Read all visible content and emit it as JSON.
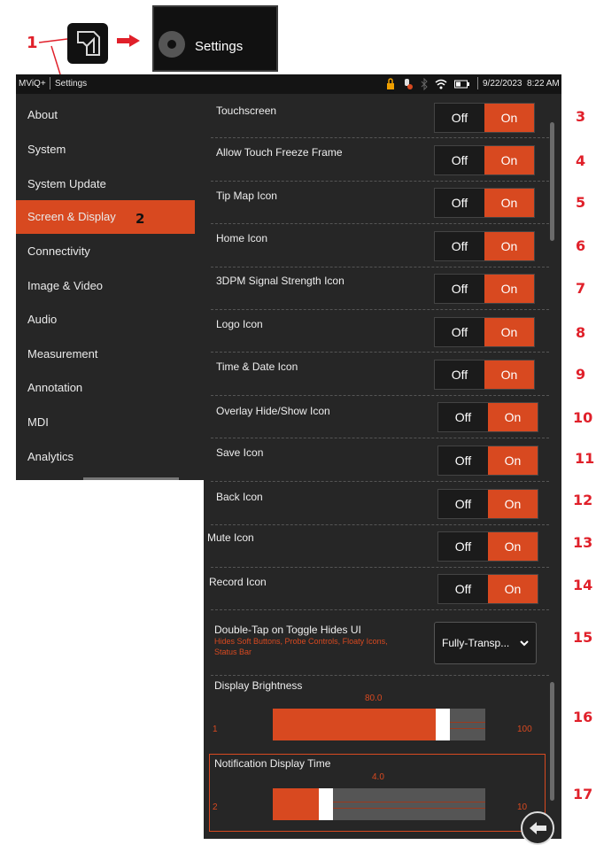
{
  "callouts": {
    "c1": "1",
    "c2": "2",
    "c3": "3",
    "c4": "4",
    "c5": "5",
    "c6": "6",
    "c7": "7",
    "c8": "8",
    "c9": "9",
    "c10": "10",
    "c11": "11",
    "c12": "12",
    "c13": "13",
    "c14": "14",
    "c15": "15",
    "c16": "16",
    "c17": "17"
  },
  "settings_tile": {
    "label": "Settings"
  },
  "statusbar": {
    "app": "MViQ+",
    "section": "Settings",
    "datetime": "9/22/2023  8:22 AM"
  },
  "sidebar": {
    "items": [
      {
        "label": "About"
      },
      {
        "label": "System"
      },
      {
        "label": "System Update"
      },
      {
        "label": "Screen & Display"
      },
      {
        "label": "Connectivity"
      },
      {
        "label": "Image & Video"
      },
      {
        "label": "Audio"
      },
      {
        "label": "Measurement"
      },
      {
        "label": "Annotation"
      },
      {
        "label": "MDI"
      },
      {
        "label": "Analytics"
      }
    ]
  },
  "toggle_labels": {
    "off": "Off",
    "on": "On"
  },
  "rows": [
    {
      "label": "Touchscreen"
    },
    {
      "label": "Allow Touch Freeze Frame"
    },
    {
      "label": "Tip Map Icon"
    },
    {
      "label": "Home Icon"
    },
    {
      "label": "3DPM Signal Strength Icon"
    },
    {
      "label": "Logo Icon"
    },
    {
      "label": "Time & Date Icon"
    },
    {
      "label": "Overlay Hide/Show Icon"
    },
    {
      "label": "Save Icon"
    },
    {
      "label": "Back Icon"
    },
    {
      "label": "Mute Icon"
    },
    {
      "label": "Record Icon"
    }
  ],
  "double_tap": {
    "label": "Double-Tap on Toggle Hides UI",
    "sub1": "Hides Soft Buttons, Probe Controls, Floaty Icons,",
    "sub2": "Status Bar",
    "value": "Fully-Transp..."
  },
  "brightness": {
    "label": "Display Brightness",
    "value": "80.0",
    "min": "1",
    "max": "100",
    "fraction": 0.8
  },
  "notification": {
    "label": "Notification Display Time",
    "value": "4.0",
    "min": "2",
    "max": "10",
    "fraction": 0.25
  },
  "colors": {
    "accent": "#d84920",
    "callout": "#e0202a",
    "panel": "#262626"
  }
}
